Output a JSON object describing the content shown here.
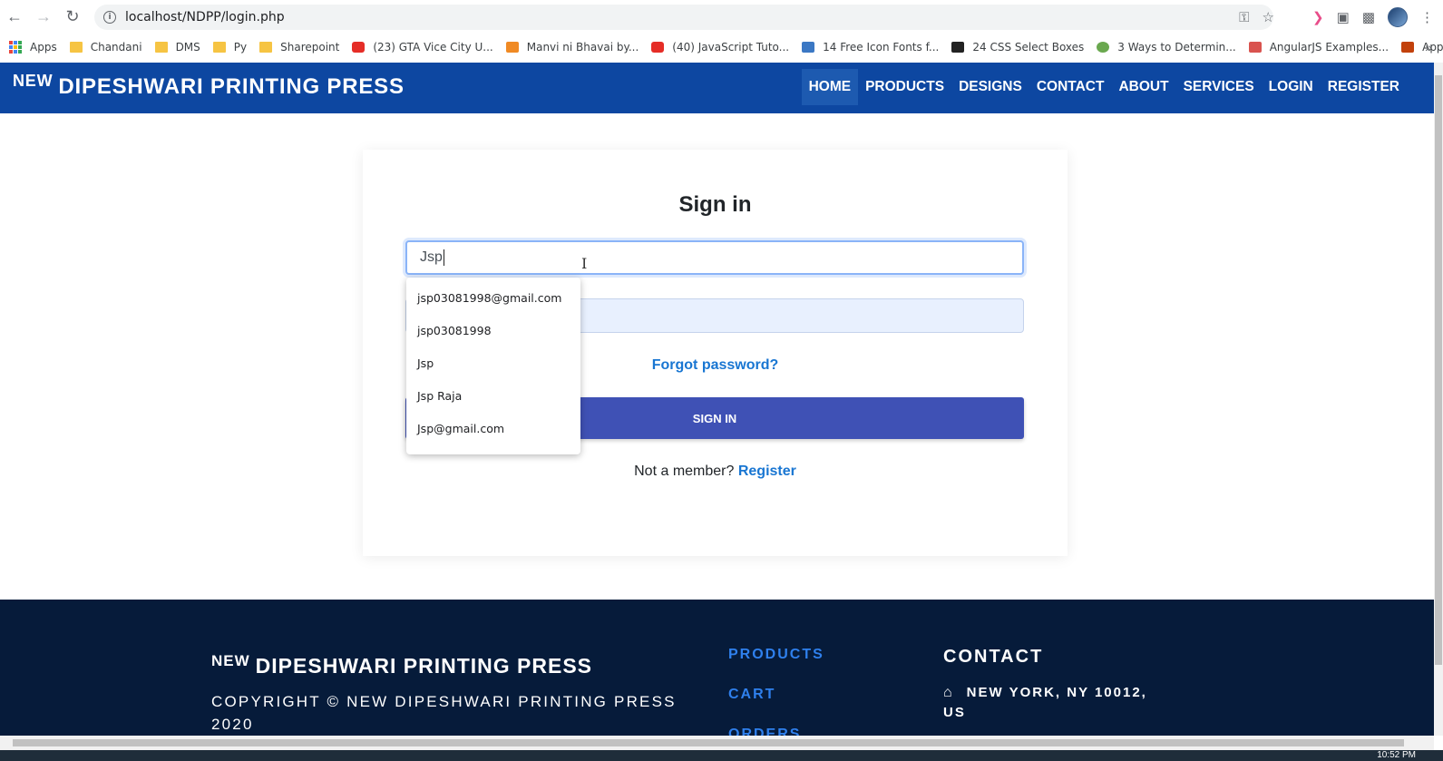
{
  "browser": {
    "url": "localhost/NDPP/login.php",
    "bookmarks": [
      {
        "label": "Apps",
        "icon": "apps"
      },
      {
        "label": "Chandani",
        "icon": "folder"
      },
      {
        "label": "DMS",
        "icon": "folder"
      },
      {
        "label": "Py",
        "icon": "folder"
      },
      {
        "label": "Sharepoint",
        "icon": "folder"
      },
      {
        "label": "(23) GTA Vice City U...",
        "icon": "yt"
      },
      {
        "label": "Manvi ni Bhavai by...",
        "icon": "orange"
      },
      {
        "label": "(40) JavaScript Tuto...",
        "icon": "yt"
      },
      {
        "label": "14 Free Icon Fonts f...",
        "icon": "fx"
      },
      {
        "label": "24 CSS Select Boxes",
        "icon": "f"
      },
      {
        "label": "3 Ways to Determin...",
        "icon": "green"
      },
      {
        "label": "AngularJS Examples...",
        "icon": "red"
      },
      {
        "label": "Applets",
        "icon": "h"
      }
    ],
    "bookmarks_more": "»",
    "clock": "10:52 PM"
  },
  "header": {
    "brand_sup": "NEW",
    "brand_main": "DIPESHWARI PRINTING PRESS",
    "nav": [
      "HOME",
      "PRODUCTS",
      "DESIGNS",
      "CONTACT",
      "ABOUT",
      "SERVICES",
      "LOGIN",
      "REGISTER"
    ]
  },
  "login": {
    "title": "Sign in",
    "email_value": "Jsp",
    "password_value": "",
    "forgot": "Forgot password?",
    "submit": "SIGN IN",
    "member_text": "Not a member?",
    "register_link": "Register"
  },
  "autofill": [
    "jsp03081998@gmail.com",
    "jsp03081998",
    "Jsp",
    "Jsp Raja",
    "Jsp@gmail.com"
  ],
  "footer": {
    "brand_sup": "NEW",
    "brand_main": "DIPESHWARI PRINTING PRESS",
    "copyright": "COPYRIGHT © NEW DIPESHWARI PRINTING PRESS 2020",
    "links": [
      "PRODUCTS",
      "CART",
      "ORDERS"
    ],
    "contact_heading": "CONTACT",
    "address": "NEW YORK, NY 10012, US"
  },
  "colors": {
    "header_bg": "#0d47a1",
    "button_bg": "#3f51b5",
    "link": "#1976d2",
    "footer_bg": "#061b3a"
  }
}
